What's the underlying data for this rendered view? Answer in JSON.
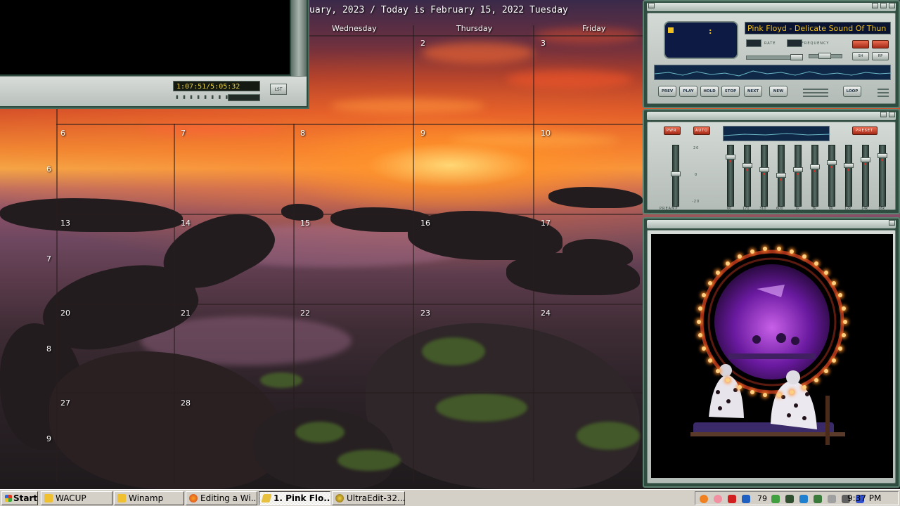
{
  "calendar": {
    "title": "uary, 2023 / Today is February 15, 2022 Tuesday",
    "day_names": [
      "Wednesday",
      "Thursday",
      "Friday"
    ],
    "dates": {
      "d2": "2",
      "d3": "3",
      "d6": "6",
      "d7": "7",
      "d8": "8",
      "d9": "9",
      "d10": "10",
      "d13": "13",
      "d14": "14",
      "d15": "15",
      "d16": "16",
      "d17": "17",
      "d20": "20",
      "d21": "21",
      "d22": "22",
      "d23": "23",
      "d24": "24",
      "d27": "27",
      "d28": "28"
    },
    "week_numbers": [
      "6",
      "7",
      "8",
      "9"
    ]
  },
  "video_player": {
    "time_display": "1:07:51/5:05:32",
    "list_label": "LST"
  },
  "winamp": {
    "song_title": "Pink Floyd - Delicate Sound Of Thun",
    "rate_label": "RATE",
    "frequency_label": "FREQUENCY",
    "controls": {
      "prev": "PREV",
      "play": "PLAY",
      "hold": "HOLD",
      "stop": "STOP",
      "next": "NEXT",
      "new": "NEW",
      "loop": "LOOP"
    },
    "toggle_labels": [
      "SH",
      "RP"
    ]
  },
  "equalizer": {
    "power_label": "PWR",
    "auto_label": "AUTO",
    "presets_label": "PRESET",
    "preamp_label": "PREAMP",
    "scale": [
      "20",
      "0",
      "-20"
    ],
    "bands": [
      "60",
      "170",
      "310",
      "600",
      "1k",
      "3k",
      "6k",
      "12k",
      "14k",
      "16k"
    ]
  },
  "album_art": {
    "description_hidden": ""
  },
  "taskbar": {
    "start_label": "Start",
    "buttons": [
      "WACUP",
      "Winamp",
      "Editing a Wi...",
      "1. Pink Flo...",
      "UltraEdit-32..."
    ],
    "tray_number": "79",
    "clock": "9:37 PM"
  },
  "colors": {
    "winamp_frame": "#2e4c40",
    "display_bg": "#0c1a44",
    "display_text": "#f0c020",
    "taskbar": "#d4d0c8"
  }
}
